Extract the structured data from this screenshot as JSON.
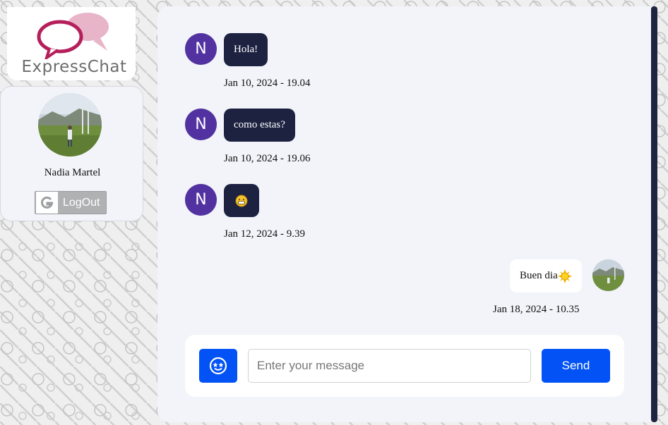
{
  "app": {
    "logo_text": "ExpressChat"
  },
  "user": {
    "name": "Nadia Martel",
    "logout_label": "LogOut"
  },
  "messages": [
    {
      "direction": "in",
      "avatar_letter": "N",
      "text": "Hola!",
      "time": "Jan 10, 2024 - 19.04"
    },
    {
      "direction": "in",
      "avatar_letter": "N",
      "text": "como estas?",
      "time": "Jan 10, 2024 - 19.06"
    },
    {
      "direction": "in",
      "avatar_letter": "N",
      "text": "",
      "emoji_icon": "grinning-face-icon",
      "time": "Jan 12, 2024 - 9.39"
    },
    {
      "direction": "out",
      "text": "Buen dia",
      "emoji_icon": "sun-icon",
      "time": "Jan 18, 2024 - 10.35"
    }
  ],
  "composer": {
    "placeholder": "Enter your message",
    "value": "",
    "send_label": "Send",
    "emoji_button_icon": "smiling-face-icon"
  },
  "colors": {
    "accent": "#0252f5",
    "incoming_bubble": "#1d2241",
    "avatar_purple": "#5232a1",
    "panel_bg": "#f2f4f9"
  }
}
